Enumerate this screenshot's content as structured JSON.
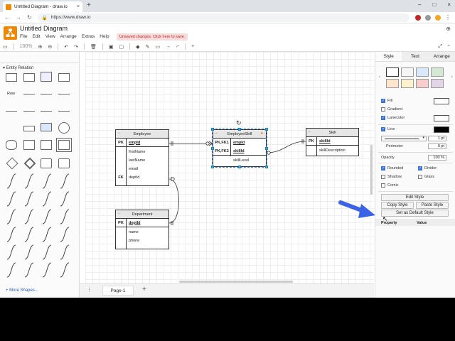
{
  "browser": {
    "tab_title": "Untitled Diagram - draw.io",
    "tab_close": "×",
    "new_tab": "+",
    "url": "https://www.draw.io",
    "window_controls": [
      "–",
      "□",
      "×"
    ]
  },
  "app": {
    "title": "Untitled Diagram",
    "menu": [
      "File",
      "Edit",
      "View",
      "Arrange",
      "Extras",
      "Help"
    ],
    "unsaved": "Unsaved changes. Click here to save.",
    "zoom": "100%"
  },
  "sidebar": {
    "section": "Entity Relation",
    "row_label": "Row",
    "more_shapes": "+ More Shapes..."
  },
  "entities": {
    "employee": {
      "title": "Employee",
      "rows": [
        {
          "key": "PK",
          "name": "empId",
          "is_key": true
        },
        {
          "key": "",
          "name": "firstName"
        },
        {
          "key": "",
          "name": "lastName"
        },
        {
          "key": "",
          "name": "email"
        },
        {
          "key": "FK",
          "name": "deptId"
        }
      ]
    },
    "department": {
      "title": "Department",
      "rows": [
        {
          "key": "PK",
          "name": "deptId",
          "is_key": true
        },
        {
          "key": "",
          "name": "name"
        },
        {
          "key": "",
          "name": "phone"
        }
      ]
    },
    "employeeskill": {
      "title": "EmployeeSkill",
      "rows": [
        {
          "key": "PK,FK1",
          "name": "empId"
        },
        {
          "key": "PK,FK2",
          "name": "skillId",
          "is_key": true
        },
        {
          "key": "",
          "name": "skillLevel"
        }
      ]
    },
    "skill": {
      "title": "Skill",
      "rows": [
        {
          "key": "PK",
          "name": "skillId",
          "is_key": true
        },
        {
          "key": "",
          "name": "skillDescription"
        }
      ]
    }
  },
  "pagebar": {
    "page_tab": "Page-1",
    "menu": "⋮",
    "add": "+"
  },
  "panel": {
    "tabs": [
      "Style",
      "Text",
      "Arrange"
    ],
    "swatch_colors": [
      "#ffffff",
      "#f5f5f5",
      "#dae8fc",
      "#d5e8d4",
      "#ffe6cc",
      "#fff2cc",
      "#f8cecc",
      "#e1d5e7"
    ],
    "fill": "Fill",
    "gradient": "Gradient",
    "label_color": "Lanecolor",
    "line": "Line",
    "line_width": "1 pt",
    "perimeter": "Perimeter",
    "perimeter_value": "0 pt",
    "opacity": "Opacity",
    "opacity_value": "100 %",
    "rounded": "Rounded",
    "divider": "Divider",
    "shadow": "Shadow",
    "glass": "Glass",
    "comic": "Comic",
    "edit_style": "Edit Style",
    "copy_style": "Copy Style",
    "paste_style": "Paste Style",
    "set_default": "Set as Default Style",
    "property": "Property",
    "value": "Value"
  }
}
